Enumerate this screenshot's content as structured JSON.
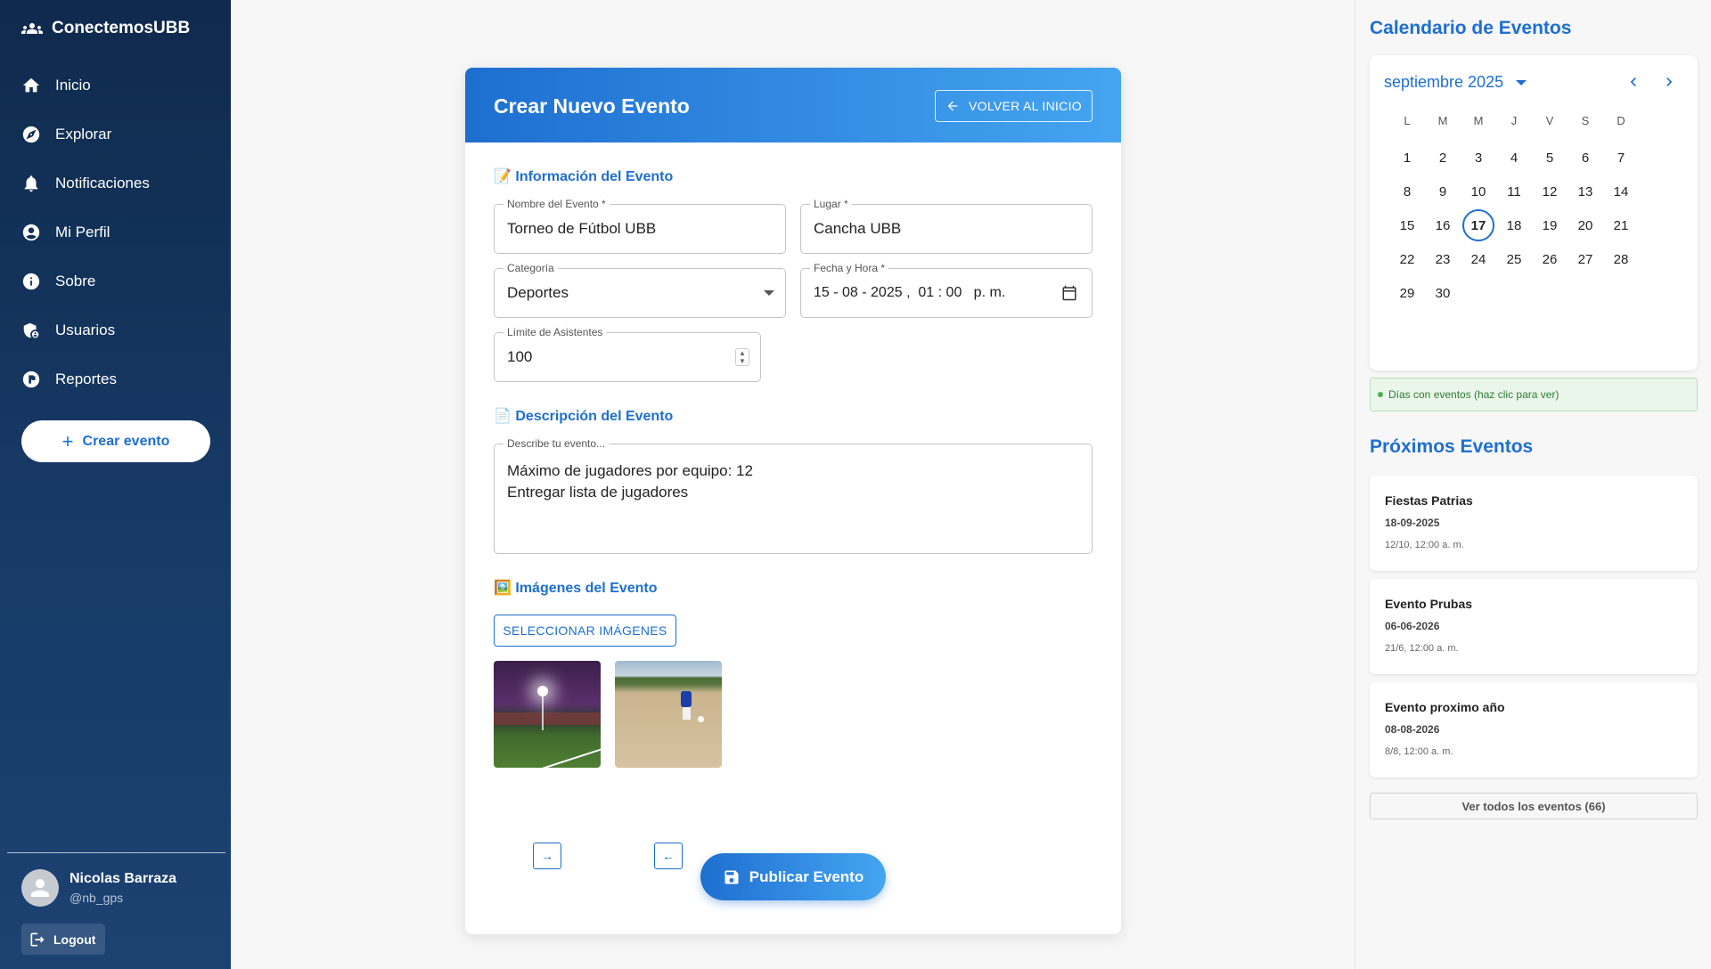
{
  "app": {
    "name": "ConectemosUBB"
  },
  "sidebar": {
    "items": [
      {
        "label": "Inicio",
        "icon": "home-icon"
      },
      {
        "label": "Explorar",
        "icon": "compass-icon"
      },
      {
        "label": "Notificaciones",
        "icon": "bell-icon"
      },
      {
        "label": "Mi Perfil",
        "icon": "account-icon"
      },
      {
        "label": "Sobre",
        "icon": "info-icon"
      },
      {
        "label": "Usuarios",
        "icon": "shield-user-icon"
      },
      {
        "label": "Reportes",
        "icon": "flag-icon"
      }
    ],
    "create_button": "Crear evento",
    "user": {
      "name": "Nicolas Barraza",
      "handle": "@nb_gps"
    },
    "logout": "Logout"
  },
  "form": {
    "title": "Crear Nuevo Evento",
    "back_button": "VOLVER AL INICIO",
    "sections": {
      "info": "📝 Información del Evento",
      "description": "📄 Descripción del Evento",
      "images": "🖼️ Imágenes del Evento"
    },
    "fields": {
      "name": {
        "label": "Nombre del Evento *",
        "value": "Torneo de Fútbol UBB"
      },
      "place": {
        "label": "Lugar *",
        "value": "Cancha UBB"
      },
      "category": {
        "label": "Categoría",
        "value": "Deportes"
      },
      "datetime": {
        "label": "Fecha y Hora *",
        "value": "15 - 08 - 2025 ,  01 : 00   p. m."
      },
      "limit": {
        "label": "Límite de Asistentes",
        "value": "100"
      },
      "description": {
        "label": "Describe tu evento...",
        "line1": "Máximo de jugadores por equipo: 12",
        "line2": "Entregar lista de jugadores"
      }
    },
    "select_images_button": "SELECCIONAR IMÁGENES",
    "image_move_right": "→",
    "image_move_left": "←",
    "publish_button": "Publicar Evento"
  },
  "calendar": {
    "title": "Calendario de Eventos",
    "month": "septiembre 2025",
    "weekdays": [
      "L",
      "M",
      "M",
      "J",
      "V",
      "S",
      "D"
    ],
    "today": 17,
    "legend": "Días con eventos (haz clic para ver)"
  },
  "upcoming": {
    "title": "Próximos Eventos",
    "events": [
      {
        "name": "Fiestas Patrias",
        "date": "18-09-2025",
        "time": "12/10, 12:00 a. m."
      },
      {
        "name": "Evento Prubas",
        "date": "06-06-2026",
        "time": "21/6, 12:00 a. m."
      },
      {
        "name": "Evento proximo año",
        "date": "08-08-2026",
        "time": "8/8, 12:00 a. m."
      }
    ],
    "view_all": "Ver todos los eventos (66)"
  },
  "colors": {
    "accent": "#1e6fd0",
    "accent_light": "#45a5f1",
    "sidebar_dark": "#0f2a4d"
  }
}
